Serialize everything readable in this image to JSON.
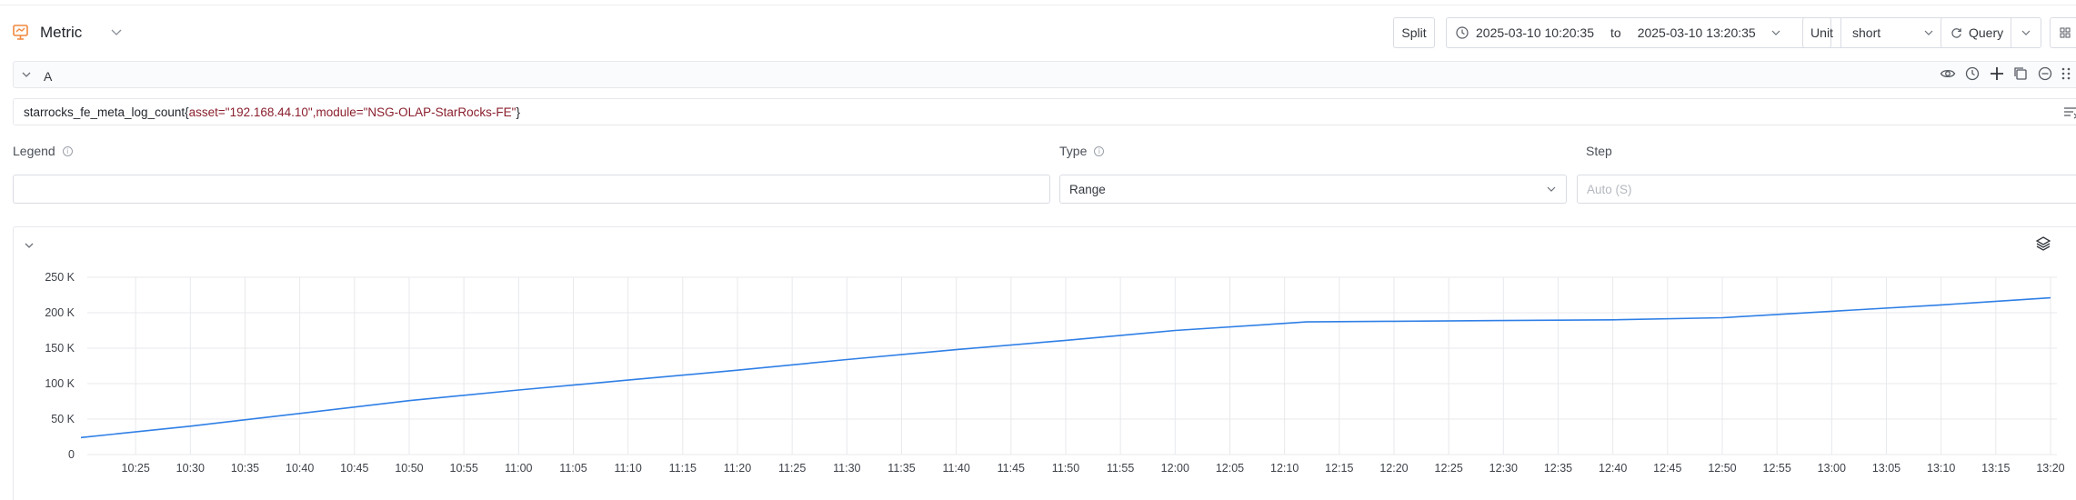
{
  "header": {
    "title": "Metric",
    "split_label": "Split",
    "time_from": "2025-03-10 10:20:35",
    "time_to_word": "to",
    "time_to": "2025-03-10 13:20:35",
    "unit_label": "Unit",
    "unit_value": "short",
    "query_label": "Query"
  },
  "query": {
    "ref_id": "A",
    "metric_name": "starrocks_fe_meta_log_count",
    "open_brace": "{",
    "labels": "asset=\"192.168.44.10\",module=\"NSG-OLAP-StarRocks-FE\"",
    "close_brace": "}"
  },
  "form": {
    "legend_label": "Legend",
    "legend_value": "",
    "type_label": "Type",
    "type_value": "Range",
    "step_label": "Step",
    "step_placeholder": "Auto  (S)"
  },
  "colors": {
    "accent": "#f0883e",
    "series": "#2f7fe6",
    "grid": "#e8e9ec",
    "axis_text": "#3d4148"
  },
  "icons": {
    "app": "monitor-icon",
    "clock": "clock-icon",
    "refresh": "refresh-icon",
    "layers": "layers-icon"
  },
  "chart_data": {
    "type": "line",
    "title": "",
    "xlabel": "",
    "ylabel": "",
    "ylim": [
      0,
      250000
    ],
    "yticks": [
      0,
      50000,
      100000,
      150000,
      200000,
      250000
    ],
    "ytick_labels": [
      "0",
      "50 K",
      "100 K",
      "150 K",
      "200 K",
      "250 K"
    ],
    "xlim": [
      "10:20:35",
      "13:20:35"
    ],
    "xtick_labels": [
      "10:25",
      "10:30",
      "10:35",
      "10:40",
      "10:45",
      "10:50",
      "10:55",
      "11:00",
      "11:05",
      "11:10",
      "11:15",
      "11:20",
      "11:25",
      "11:30",
      "11:35",
      "11:40",
      "11:45",
      "11:50",
      "11:55",
      "12:00",
      "12:05",
      "12:10",
      "12:15",
      "12:20",
      "12:25",
      "12:30",
      "12:35",
      "12:40",
      "12:45",
      "12:50",
      "12:55",
      "13:00",
      "13:05",
      "13:10",
      "13:15",
      "13:20"
    ],
    "grid": true,
    "series": [
      {
        "x": [
          "10:20",
          "10:30",
          "10:40",
          "10:50",
          "11:00",
          "11:10",
          "11:20",
          "11:30",
          "11:40",
          "11:50",
          "12:00",
          "12:10",
          "12:12",
          "12:20",
          "12:30",
          "12:40",
          "12:50",
          "13:00",
          "13:10",
          "13:20"
        ],
        "y": [
          24000,
          40000,
          58000,
          76000,
          91000,
          105000,
          119000,
          134000,
          148000,
          161000,
          175000,
          185000,
          187000,
          188000,
          189000,
          190000,
          193000,
          202000,
          211000,
          221000
        ]
      }
    ]
  }
}
